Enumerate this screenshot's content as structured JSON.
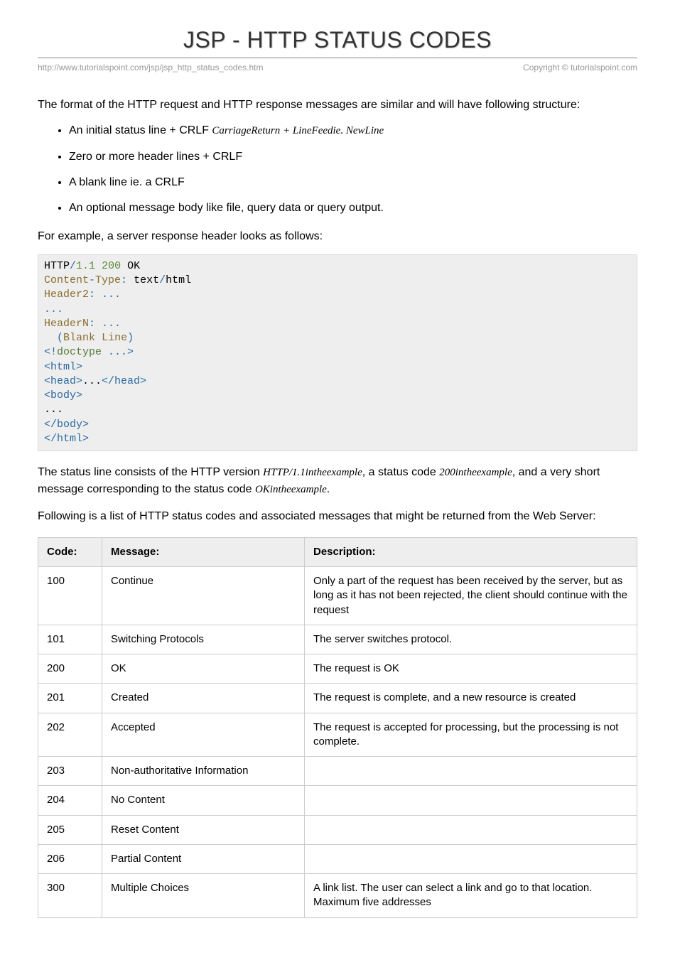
{
  "title": "JSP - HTTP STATUS CODES",
  "url": "http://www.tutorialspoint.com/jsp/jsp_http_status_codes.htm",
  "copyright": "Copyright © tutorialspoint.com",
  "intro": "The format of the HTTP request and HTTP response messages are similar and will have following structure:",
  "bullets": {
    "b1_head": "An initial status line + CRLF ",
    "b1_tail": "CarriageReturn + LineFeedie. NewLine",
    "b2": "Zero or more header lines + CRLF",
    "b3": "A blank line ie. a CRLF",
    "b4": "An optional message body like file, query data or query output."
  },
  "example_lead": "For example, a server response header looks as follows:",
  "post_code_1_a": "The status line consists of the HTTP version ",
  "post_code_1_b": "HTTP/1.1intheexample",
  "post_code_1_c": ", a status code ",
  "post_code_1_d": "200intheexample",
  "post_code_1_e": ", and a very short message corresponding to the status code ",
  "post_code_1_f": "OKintheexample",
  "post_code_1_g": ".",
  "post_code_2": "Following is a list of HTTP status codes and associated messages that might be returned from the Web Server:",
  "table": {
    "headers": {
      "code": "Code:",
      "message": "Message:",
      "description": "Description:"
    },
    "rows": [
      {
        "code": "100",
        "message": "Continue",
        "description": "Only a part of the request has been received by the server, but as long as it has not been rejected, the client should continue with the request"
      },
      {
        "code": "101",
        "message": "Switching Protocols",
        "description": "The server switches protocol."
      },
      {
        "code": "200",
        "message": "OK",
        "description": "The request is OK"
      },
      {
        "code": "201",
        "message": "Created",
        "description": "The request is complete, and a new resource is created"
      },
      {
        "code": "202",
        "message": "Accepted",
        "description": "The request is accepted for processing, but the processing is not complete."
      },
      {
        "code": "203",
        "message": "Non-authoritative Information",
        "description": ""
      },
      {
        "code": "204",
        "message": "No Content",
        "description": ""
      },
      {
        "code": "205",
        "message": "Reset Content",
        "description": ""
      },
      {
        "code": "206",
        "message": "Partial Content",
        "description": ""
      },
      {
        "code": "300",
        "message": "Multiple Choices",
        "description": "A link list. The user can select a link and go to that location. Maximum five addresses"
      }
    ]
  }
}
